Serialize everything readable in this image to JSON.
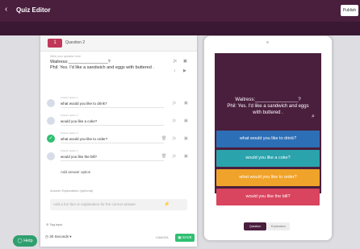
{
  "topbar": {
    "back_icon": "chevron-left",
    "title": "Quiz Editor",
    "publish": "Publish"
  },
  "question": {
    "badge": "1",
    "label": "Question 2",
    "text_label": "Write your question here",
    "line1": "Waitress:________________?",
    "line2": "Phil: Yes. I'd like a sandwich and eggs with buttered ."
  },
  "answers": [
    {
      "label": "Answer option 1",
      "text": "what would you like to drink?",
      "correct": false
    },
    {
      "label": "Answer option 2",
      "text": "would you like a coke?",
      "correct": false
    },
    {
      "label": "Answer option 3",
      "text": "what would you like to order?",
      "correct": true
    },
    {
      "label": "Answer option 4",
      "text": "would you like the bill?",
      "correct": false
    }
  ],
  "add_answer": "Add answer option",
  "explanation": {
    "label": "Answer Explanation (optional)",
    "placeholder": "Add a fun fact or explanation for the correct answer"
  },
  "tag": "Tag topic",
  "footer": {
    "timer": "30 Seconds",
    "cancel": "CANCEL",
    "save": "SAVE"
  },
  "help": "Help",
  "preview": {
    "line1": "Waitress:________________?",
    "line2": "Phil: Yes. I'd like a sandwich and eggs",
    "line3": "with buttered .",
    "options": [
      {
        "text": "what would you like to drink?",
        "color": "#2d6fb6"
      },
      {
        "text": "would you like a coke?",
        "color": "#2ba3ad"
      },
      {
        "text": "what would you like to order?",
        "color": "#f0a32a"
      },
      {
        "text": "would you like the bill?",
        "color": "#d9445e"
      }
    ],
    "tabs": [
      "Question",
      "Explanation"
    ]
  },
  "colors": {
    "header": "#4a1e3d",
    "correct": "#2fbf71",
    "badge": "#c0375a"
  }
}
